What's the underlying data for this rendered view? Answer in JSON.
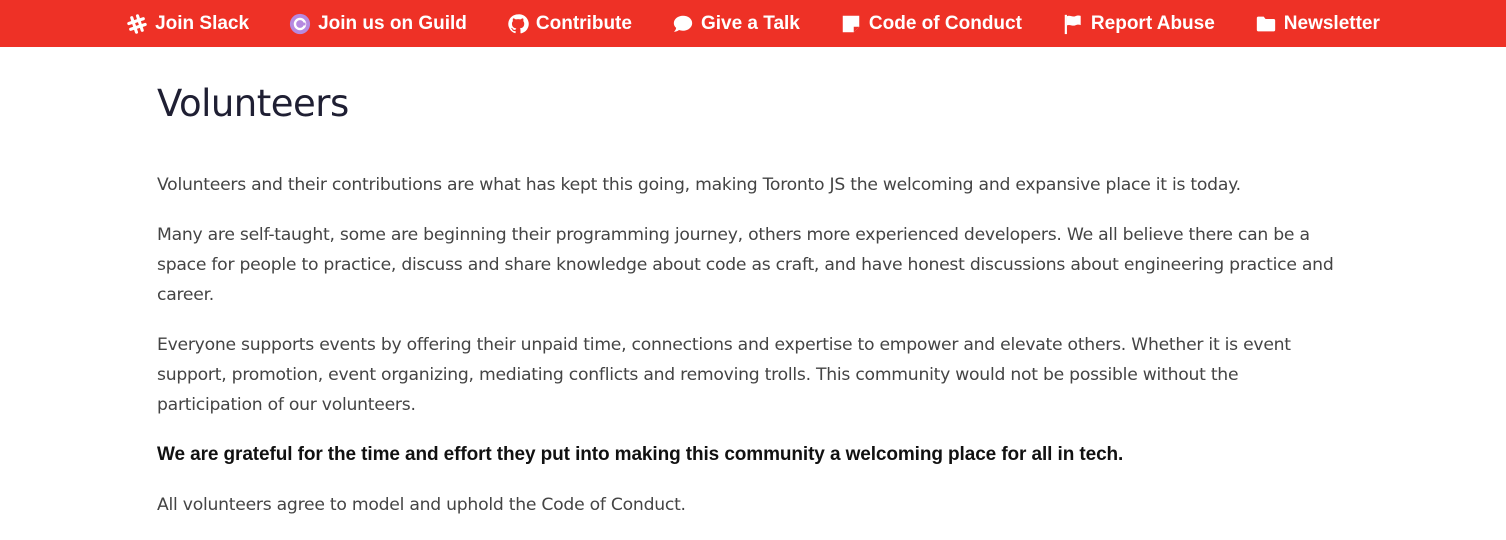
{
  "nav": {
    "bg_color": "#ee3126",
    "items": [
      {
        "label": "Join Slack",
        "icon": "slack-icon"
      },
      {
        "label": "Join us on Guild",
        "icon": "guild-icon"
      },
      {
        "label": "Contribute",
        "icon": "github-icon"
      },
      {
        "label": "Give a Talk",
        "icon": "speech-bubble-icon"
      },
      {
        "label": "Code of Conduct",
        "icon": "sticky-note-icon"
      },
      {
        "label": "Report Abuse",
        "icon": "flag-icon"
      },
      {
        "label": "Newsletter",
        "icon": "folder-icon"
      }
    ]
  },
  "main": {
    "title": "Volunteers",
    "paragraphs": [
      "Volunteers and their contributions are what has kept this going, making Toronto JS the welcoming and expansive place it is today.",
      "Many are self-taught, some are beginning their programming journey, others more experienced developers. We all believe there can be a space for people to practice, discuss and share knowledge about code as craft, and have honest discussions about engineering practice and career.",
      "Everyone supports events by offering their unpaid time, connections and expertise to empower and elevate others. Whether it is event support, promotion, event organizing, mediating conflicts and removing trolls. This community would not be possible without the participation of our volunteers.",
      "We are grateful for the time and effort they put into making this community a welcoming place for all in tech.",
      "All volunteers agree to model and uphold the Code of Conduct."
    ]
  }
}
